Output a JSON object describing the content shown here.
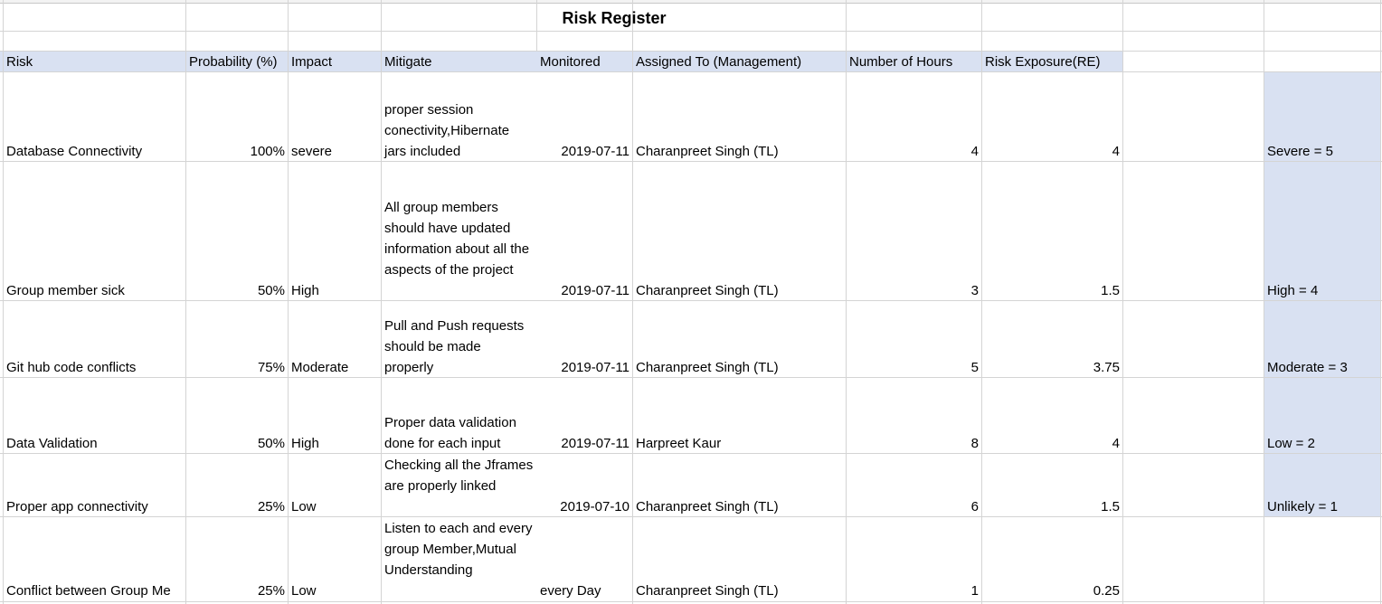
{
  "title": "Risk Register",
  "headers": {
    "risk": "Risk",
    "probability": "Probability (%)",
    "impact": "Impact",
    "mitigate": "Mitigate",
    "monitored": "Monitored",
    "assigned": "Assigned To (Management)",
    "hours": "Number of Hours",
    "exposure": "Risk Exposure(RE)"
  },
  "rows": [
    {
      "risk": "Database Connectivity",
      "probability": "100%",
      "impact": "severe",
      "mitigate": "proper session conectivity,Hibernate jars included",
      "monitored": "2019-07-11",
      "assigned": "Charanpreet Singh (TL)",
      "hours": "4",
      "exposure": "4",
      "scale": "Severe = 5"
    },
    {
      "risk": "Group member sick",
      "probability": "50%",
      "impact": "High",
      "mitigate": "All group members should have updated information about all the aspects of the project",
      "monitored": "2019-07-11",
      "assigned": "Charanpreet Singh (TL)",
      "hours": "3",
      "exposure": "1.5",
      "scale": "High = 4"
    },
    {
      "risk": "Git hub code conflicts",
      "probability": "75%",
      "impact": "Moderate",
      "mitigate": "Pull and Push requests should be made properly",
      "monitored": "2019-07-11",
      "assigned": "Charanpreet Singh (TL)",
      "hours": "5",
      "exposure": "3.75",
      "scale": "Moderate = 3"
    },
    {
      "risk": "Data Validation",
      "probability": "50%",
      "impact": "High",
      "mitigate": "Proper data validation done for each input",
      "monitored": "2019-07-11",
      "assigned": "Harpreet Kaur",
      "hours": "8",
      "exposure": "4",
      "scale": "Low = 2"
    },
    {
      "risk": "Proper app connectivity",
      "probability": "25%",
      "impact": "Low",
      "mitigate": "Checking all the Jframes are properly linked",
      "monitored": "2019-07-10",
      "assigned": "Charanpreet Singh (TL)",
      "hours": "6",
      "exposure": "1.5",
      "scale": "Unlikely = 1"
    },
    {
      "risk": "Conflict between Group Me",
      "probability": "25%",
      "impact": "Low",
      "mitigate": "Listen to each and every group Member,Mutual Understanding",
      "monitored": "every Day",
      "assigned": "Charanpreet Singh (TL)",
      "hours": "1",
      "exposure": "0.25",
      "scale": ""
    }
  ]
}
